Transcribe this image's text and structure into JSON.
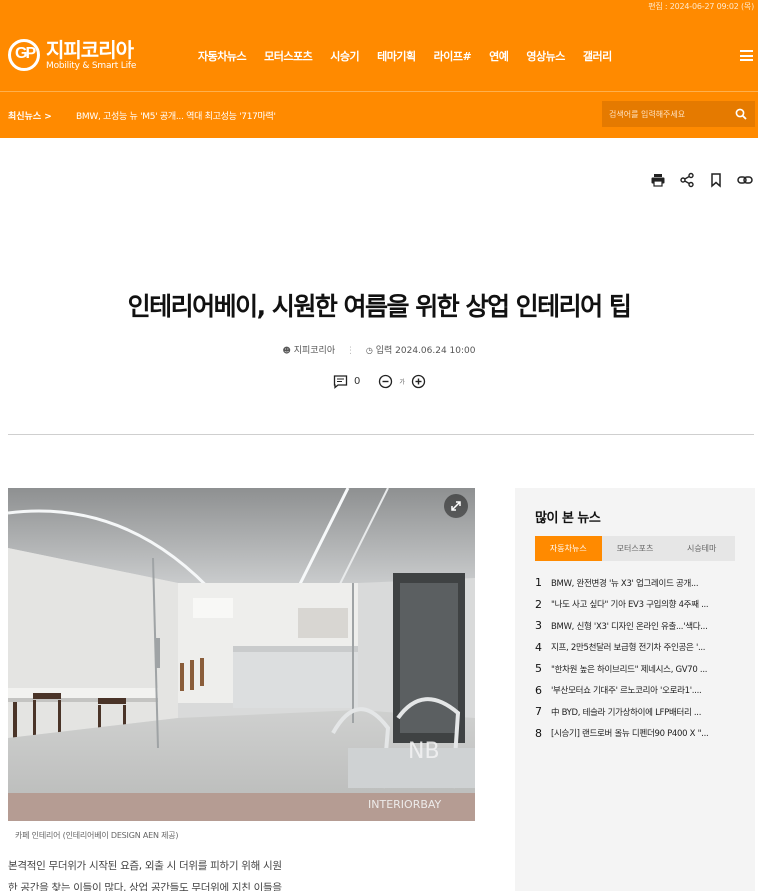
{
  "header": {
    "edit_time": "편집 : 2024-06-27 09:02 (목)",
    "logo": {
      "name": "지피코리아",
      "subtitle": "Mobility & Smart Life",
      "mark": "GP"
    },
    "nav": [
      "자동차뉴스",
      "모터스포츠",
      "시승기",
      "테마기획",
      "라이프#",
      "연예",
      "영상뉴스",
      "갤러리"
    ],
    "breaking_label": "최신뉴스 >",
    "breaking_text": "BMW, 고성능 뉴 'M5' 공개... 역대 최고성능 '717마력'",
    "search_placeholder": "검색어를 입력해주세요",
    "accent": "#ff8a00"
  },
  "article": {
    "title": "인테리어베이, 시원한 여름을 위한 상업 인테리어 팁",
    "author": "지피코리아",
    "date": "입력 2024.06.24 10:00",
    "comment_count": "0",
    "font_label": "가",
    "caption": "카페 인테리어 (인테리어베이 DESIGN AEN 제공)",
    "photo_watermark": "INTERIORBAY",
    "body_lines": [
      "본격적인 무더위가 시작된 요즘, 외출 시 더위를 피하기 위해 시원",
      "한 공간을 찾는 이들이 많다. 상업 공간들도 무더위에 지친 이들을"
    ]
  },
  "sidebar": {
    "title": "많이 본 뉴스",
    "tabs": [
      "자동차뉴스",
      "모터스포츠",
      "시승테마"
    ],
    "items": [
      {
        "num": "1",
        "text": "BMW, 완전변경 '뉴 X3' 업그레이드 공개..."
      },
      {
        "num": "2",
        "text": "\"나도 사고 싶다\" 기아 EV3 구입의향 4주째 ..."
      },
      {
        "num": "3",
        "text": "BMW, 신형 'X3' 디자인 온라인 유출...'색다..."
      },
      {
        "num": "4",
        "text": "지프, 2만5천달러 보급형 전기차 주인공은 '..."
      },
      {
        "num": "5",
        "text": "\"한차원 높은 하이브리드\" 제네시스, GV70 ..."
      },
      {
        "num": "6",
        "text": "'부산모터쇼 기대주' 르노코리아 '오로라1'...."
      },
      {
        "num": "7",
        "text": "中 BYD, 테슬라 기가상하이에 LFP배터리 ..."
      },
      {
        "num": "8",
        "text": "[시승기] 랜드로버 올뉴 디펜더90 P400 X \"..."
      }
    ]
  }
}
